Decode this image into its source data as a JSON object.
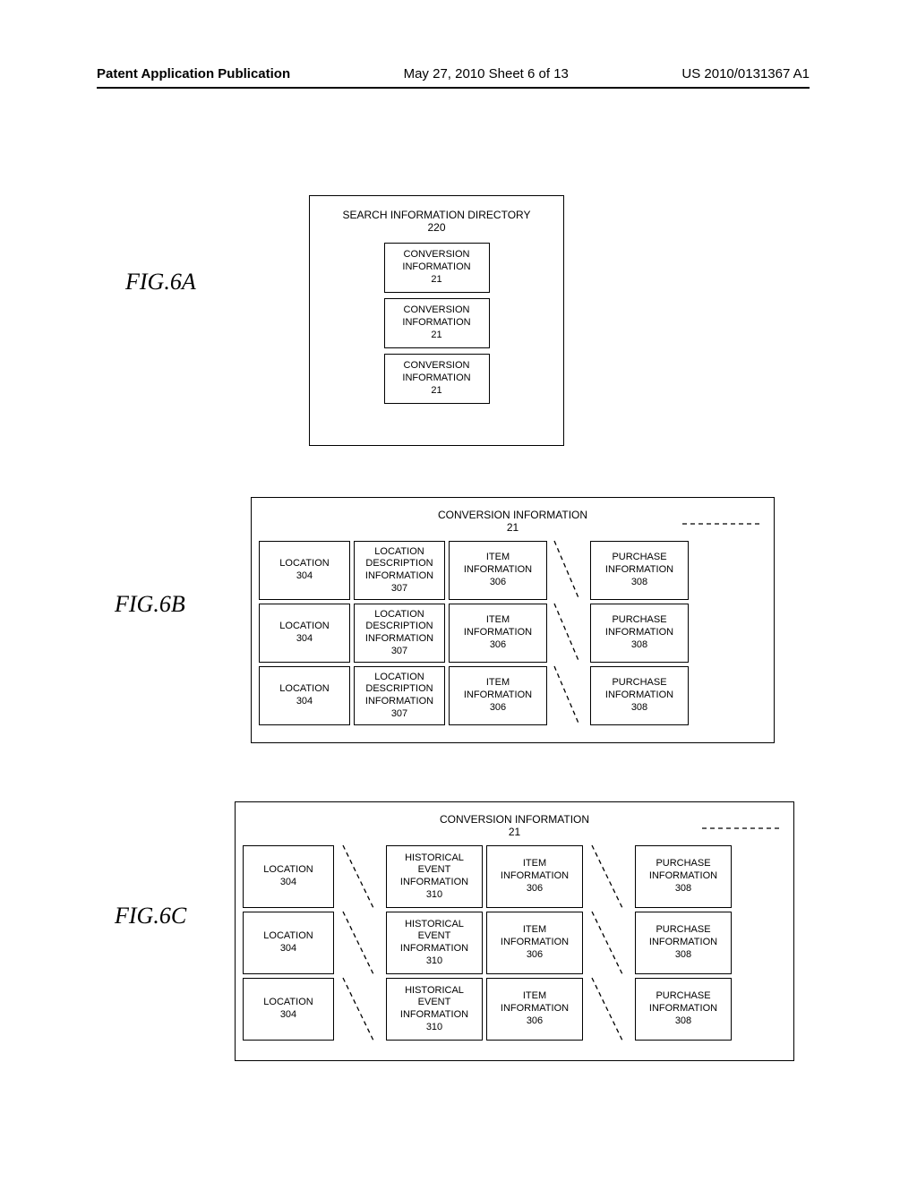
{
  "header": {
    "left": "Patent Application Publication",
    "mid": "May 27, 2010  Sheet 6 of 13",
    "right": "US 2010/0131367 A1"
  },
  "fig6a": {
    "label": "FIG.6A",
    "outer_title": "SEARCH INFORMATION DIRECTORY",
    "outer_num": "220",
    "inner_label": "CONVERSION INFORMATION",
    "inner_num": "21"
  },
  "fig6b": {
    "label": "FIG.6B",
    "title": "CONVERSION INFORMATION",
    "title_num": "21",
    "cells": {
      "location": "LOCATION",
      "location_num": "304",
      "locdesc": "LOCATION DESCRIPTION INFORMATION",
      "locdesc_num": "307",
      "item": "ITEM INFORMATION",
      "item_num": "306",
      "purchase": "PURCHASE INFORMATION",
      "purchase_num": "308"
    }
  },
  "fig6c": {
    "label": "FIG.6C",
    "title": "CONVERSION INFORMATION",
    "title_num": "21",
    "cells": {
      "location": "LOCATION",
      "location_num": "304",
      "hist": "HISTORICAL EVENT INFORMATION",
      "hist_num": "310",
      "item": "ITEM INFORMATION",
      "item_num": "306",
      "purchase": "PURCHASE INFORMATION",
      "purchase_num": "308"
    }
  }
}
